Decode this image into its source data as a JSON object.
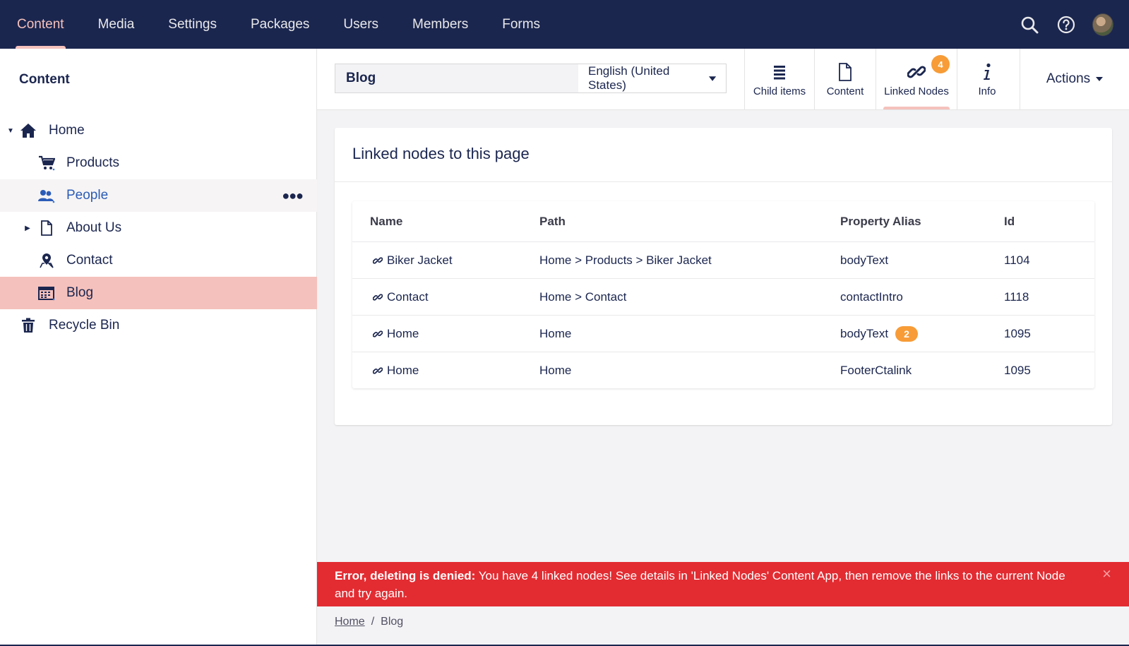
{
  "topnav": {
    "items": [
      "Content",
      "Media",
      "Settings",
      "Packages",
      "Users",
      "Members",
      "Forms"
    ],
    "active_index": 0,
    "tools": [
      "search-icon",
      "help-icon",
      "avatar"
    ]
  },
  "sidebar": {
    "title": "Content",
    "tree": [
      {
        "label": "Home",
        "icon": "home-icon",
        "caret": "expanded"
      },
      {
        "label": "Products",
        "icon": "cart-icon"
      },
      {
        "label": "People",
        "icon": "people-icon",
        "state": "hover"
      },
      {
        "label": "About Us",
        "icon": "document-icon",
        "caret": "collapsed"
      },
      {
        "label": "Contact",
        "icon": "map-pin-icon"
      },
      {
        "label": "Blog",
        "icon": "calendar-icon",
        "state": "selected"
      },
      {
        "label": "Recycle Bin",
        "icon": "trash-icon"
      }
    ]
  },
  "header": {
    "name": "Blog",
    "language": "English (United States)",
    "apps": [
      {
        "label": "Child items",
        "icon": "list-icon"
      },
      {
        "label": "Content",
        "icon": "document-icon"
      },
      {
        "label": "Linked Nodes",
        "icon": "link-icon",
        "badge": "4",
        "active": true
      },
      {
        "label": "Info",
        "icon": "info-icon"
      }
    ],
    "actions_label": "Actions"
  },
  "panel": {
    "title": "Linked nodes to this page",
    "columns": [
      "Name",
      "Path",
      "Property Alias",
      "Id"
    ],
    "rows": [
      {
        "name": "Biker Jacket",
        "path": "Home > Products > Biker Jacket",
        "alias": "bodyText",
        "count": "",
        "id": "1104"
      },
      {
        "name": "Contact",
        "path": "Home > Contact",
        "alias": "contactIntro",
        "count": "",
        "id": "1118"
      },
      {
        "name": "Home",
        "path": "Home",
        "alias": "bodyText",
        "count": "2",
        "id": "1095"
      },
      {
        "name": "Home",
        "path": "Home",
        "alias": "FooterCtalink",
        "count": "",
        "id": "1095"
      }
    ]
  },
  "error": {
    "strong": "Error, deleting is denied:",
    "message": " You have 4 linked nodes! See details in 'Linked Nodes' Content App, then remove the links to the current Node and try again.",
    "close": "×"
  },
  "breadcrumb": {
    "items": [
      "Home",
      "Blog"
    ],
    "separator": "/"
  },
  "colors": {
    "topbar": "#1b264f",
    "accent": "#f5c1bc",
    "badge": "#f79c37",
    "error": "#e22c32"
  }
}
